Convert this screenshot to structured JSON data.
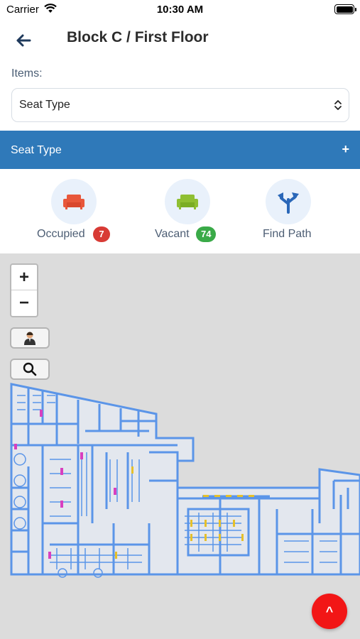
{
  "status_bar": {
    "carrier": "Carrier",
    "time": "10:30 AM"
  },
  "header": {
    "title": "Block C / First Floor",
    "back_icon": "arrow-left-icon"
  },
  "items": {
    "label": "Items:",
    "select_value": "Seat Type",
    "chevron_icon": "chevron-up-down-icon"
  },
  "accordion": {
    "title": "Seat Type",
    "toggle": "+"
  },
  "filters": [
    {
      "label": "Occupied",
      "count": "7",
      "icon": "sofa-icon",
      "icon_color": "#e8573a",
      "badge_color": "#d83b35"
    },
    {
      "label": "Vacant",
      "count": "74",
      "icon": "sofa-icon",
      "icon_color": "#8fbf32",
      "badge_color": "#3aaa48"
    },
    {
      "label": "Find Path",
      "icon": "directions-icon",
      "icon_color": "#2a67b8"
    }
  ],
  "map": {
    "zoom_in": "+",
    "zoom_out": "−",
    "person_icon": "person-icon",
    "search_icon": "search-icon",
    "scroll_top": "^",
    "colors": {
      "walls": "#5b95e8",
      "occupied": "#d83fbf",
      "vacant": "#e5c02a",
      "background": "#dcdcdc"
    }
  },
  "colors": {
    "accent": "#2f79b9",
    "fab": "#f21616"
  }
}
